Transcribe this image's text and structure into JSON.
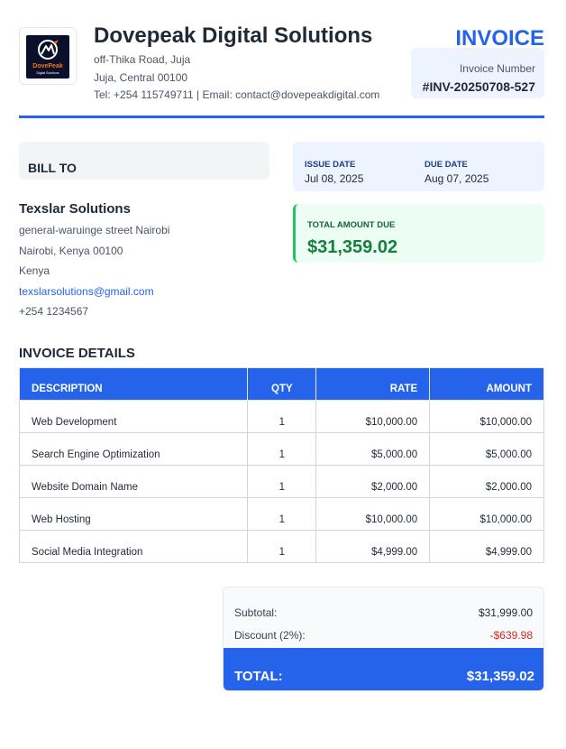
{
  "company": {
    "logo_name": "DovePeak",
    "logo_tagline": "Digital Solutions",
    "name": "Dovepeak Digital Solutions",
    "address_line1": "off-Thika Road, Juja",
    "address_line2": "Juja, Central 00100",
    "contact": "Tel: +254 115749711 | Email: contact@dovepeakdigital.com"
  },
  "invoice": {
    "title": "INVOICE",
    "number_label": "Invoice Number",
    "number": "#INV-20250708-527"
  },
  "bill_to": {
    "label": "BILL TO",
    "client_name": "Texslar Solutions",
    "street": "general-waruinge street Nairobi",
    "city": "Nairobi, Kenya 00100",
    "country": "Kenya",
    "email": "texslarsolutions@gmail.com",
    "phone": "+254 1234567"
  },
  "dates": {
    "issue_label": "ISSUE DATE",
    "issue_value": "Jul 08, 2025",
    "due_label": "DUE DATE",
    "due_value": "Aug 07, 2025"
  },
  "total_due": {
    "label": "TOTAL AMOUNT DUE",
    "value": "$31,359.02"
  },
  "details": {
    "title": "INVOICE DETAILS",
    "headers": [
      "DESCRIPTION",
      "QTY",
      "RATE",
      "AMOUNT"
    ],
    "rows": [
      [
        "Web Development",
        "1",
        "$10,000.00",
        "$10,000.00"
      ],
      [
        "Search Engine Optimization",
        "1",
        "$5,000.00",
        "$5,000.00"
      ],
      [
        "Website Domain Name",
        "1",
        "$2,000.00",
        "$2,000.00"
      ],
      [
        "Web Hosting",
        "1",
        "$10,000.00",
        "$10,000.00"
      ],
      [
        "Social Media Integration",
        "1",
        "$4,999.00",
        "$4,999.00"
      ]
    ]
  },
  "summary": {
    "subtotal_label": "Subtotal:",
    "subtotal_value": "$31,999.00",
    "discount_label": "Discount (2%):",
    "discount_value": "-$639.98",
    "total_label": "TOTAL:",
    "total_value": "$31,359.02"
  },
  "colors": {
    "accent": "#2563eb",
    "success": "#15803d",
    "danger": "#dc2626"
  }
}
